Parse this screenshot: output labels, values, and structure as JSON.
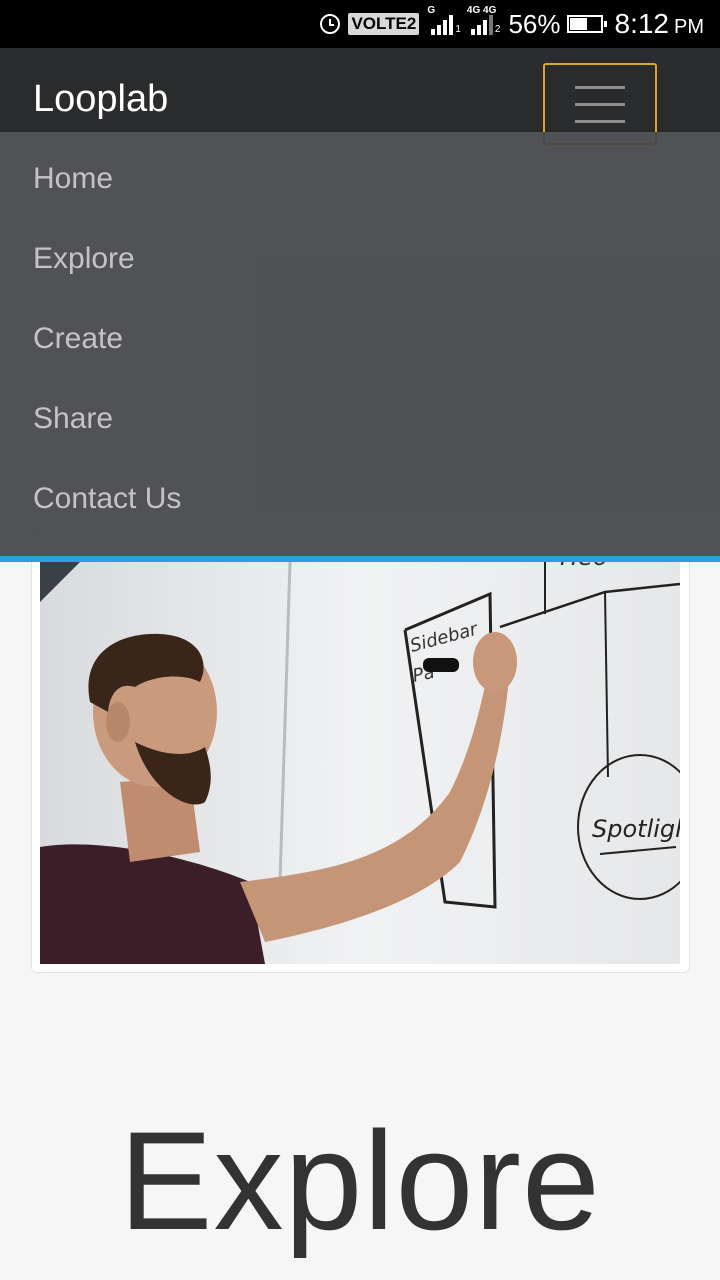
{
  "status_bar": {
    "volte": "VOLTE2",
    "sim1_label": "G",
    "sim1_num": "1",
    "sim2_label": "4G 4G",
    "sim2_num": "2",
    "battery": "56%",
    "time": "8:12",
    "ampm": "PM"
  },
  "navbar": {
    "brand": "Looplab",
    "menu": [
      "Home",
      "Explore",
      "Create",
      "Share",
      "Contact Us"
    ]
  },
  "colors": {
    "navbar_bg": "#2a2b2c",
    "menu_bg": "#424346",
    "accent_border": "#d9a72b",
    "blue_line": "#2d9fd9"
  },
  "hero_image": {
    "whiteboard_text": [
      "Heo",
      "Sidebar",
      "Pa",
      "Spotlight"
    ]
  },
  "section": {
    "title": "Explore"
  }
}
